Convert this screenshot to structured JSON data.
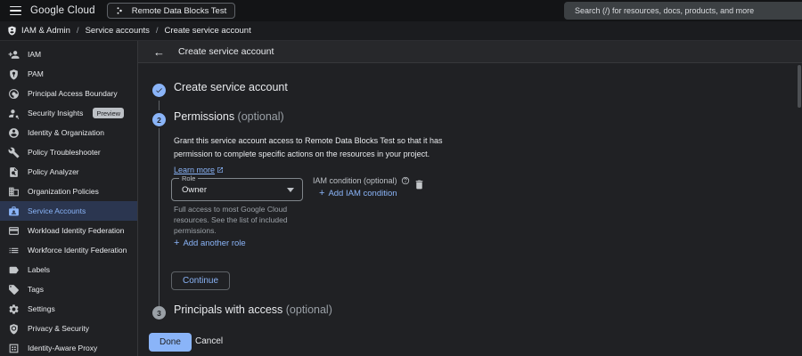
{
  "colors": {
    "accent_blue": "#8ab4f8",
    "selected_item_bg": "#2b3650",
    "text_primary": "#e8eaed",
    "text_secondary": "#9aa0a6",
    "done_button_bg": "#8ab4f8",
    "done_button_text": "#202124",
    "topbar_bg": "#131416",
    "search_bg": "#3c4043"
  },
  "topbar": {
    "logo": "Google Cloud",
    "project": "Remote Data Blocks Test",
    "search_placeholder": "Search (/) for resources, docs, products, and more"
  },
  "breadcrumb": {
    "items": [
      "IAM & Admin",
      "Service accounts",
      "Create service account"
    ],
    "separator": "/"
  },
  "sidebar": {
    "items": [
      {
        "label": "IAM",
        "icon": "person-add-icon",
        "selected": false
      },
      {
        "label": "PAM",
        "icon": "shield-key-icon",
        "selected": false
      },
      {
        "label": "Principal Access Boundary",
        "icon": "boundary-icon",
        "selected": false
      },
      {
        "label": "Security Insights",
        "icon": "person-search-icon",
        "selected": false,
        "badge": "Preview"
      },
      {
        "label": "Identity & Organization",
        "icon": "person-circle-icon",
        "selected": false
      },
      {
        "label": "Policy Troubleshooter",
        "icon": "wrench-icon",
        "selected": false
      },
      {
        "label": "Policy Analyzer",
        "icon": "doc-search-icon",
        "selected": false
      },
      {
        "label": "Organization Policies",
        "icon": "org-policies-icon",
        "selected": false
      },
      {
        "label": "Service Accounts",
        "icon": "service-accounts-icon",
        "selected": true
      },
      {
        "label": "Workload Identity Federation",
        "icon": "card-icon",
        "selected": false
      },
      {
        "label": "Workforce Identity Federation",
        "icon": "list-icon",
        "selected": false
      },
      {
        "label": "Labels",
        "icon": "label-icon",
        "selected": false
      },
      {
        "label": "Tags",
        "icon": "tag-icon",
        "selected": false
      },
      {
        "label": "Settings",
        "icon": "gear-icon",
        "selected": false
      },
      {
        "label": "Privacy & Security",
        "icon": "shield-globe-icon",
        "selected": false
      },
      {
        "label": "Identity-Aware Proxy",
        "icon": "proxy-grid-icon",
        "selected": false
      }
    ]
  },
  "page_header": {
    "title": "Create service account",
    "back_glyph": "←"
  },
  "wizard": {
    "step1": {
      "title": "Create service account"
    },
    "step2": {
      "number": "2",
      "title": "Permissions ",
      "suffix": "(optional)",
      "description": "Grant this service account access to Remote Data Blocks Test so that it has permission to complete specific actions on the resources in your project.",
      "learn_more": "Learn more",
      "role": {
        "label": "Role",
        "value": "Owner",
        "helper": "Full access to most Google Cloud resources. See the list of included permissions."
      },
      "iam_condition": {
        "label": "IAM condition (optional)",
        "add_link": "Add IAM condition",
        "plus": "+"
      },
      "add_another_role": "Add another role",
      "add_plus": "+",
      "continue_label": "Continue"
    },
    "step3": {
      "number": "3",
      "title": "Principals with access ",
      "suffix": "(optional)"
    },
    "done_label": "Done",
    "cancel_label": "Cancel"
  }
}
